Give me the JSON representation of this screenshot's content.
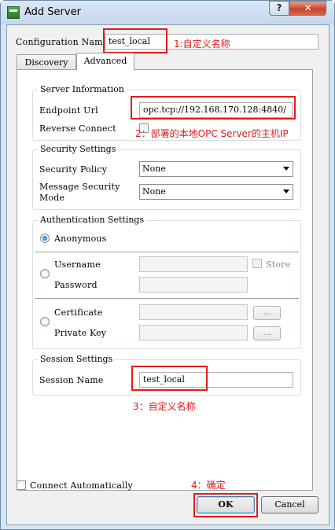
{
  "window": {
    "title": "Add Server",
    "help_label": "?",
    "close_label": "✕"
  },
  "config": {
    "label": "Configuration Name",
    "value": "test_local"
  },
  "tabs": [
    {
      "label": "Discovery"
    },
    {
      "label": "Advanced"
    }
  ],
  "server_info": {
    "title": "Server Information",
    "endpoint_label": "Endpoint Url",
    "endpoint_value": "opc.tcp://192.168.170.128:4840/",
    "reverse_label": "Reverse Connect"
  },
  "security": {
    "title": "Security Settings",
    "policy_label": "Security Policy",
    "policy_value": "None",
    "mode_label_line1": "Message Security",
    "mode_label_line2": "Mode",
    "mode_value": "None"
  },
  "auth": {
    "title": "Authentication Settings",
    "anonymous_label": "Anonymous",
    "username_label": "Username",
    "password_label": "Password",
    "store_label": "Store",
    "certificate_label": "Certificate",
    "private_key_label": "Private Key",
    "browse_label": "..."
  },
  "session": {
    "title": "Session Settings",
    "name_label": "Session Name",
    "name_value": "test_local"
  },
  "footer": {
    "connect_auto_label": "Connect Automatically",
    "ok_label": "OK",
    "cancel_label": "Cancel"
  },
  "annotations": {
    "note1": "1:自定义名称",
    "note2": "2：部署的本地OPC Server的主机IP",
    "note3": "3：自定义名称",
    "note4": "4：确定"
  },
  "colors": {
    "annotation": "#e01919",
    "title_bar": "#c6d8ec"
  }
}
